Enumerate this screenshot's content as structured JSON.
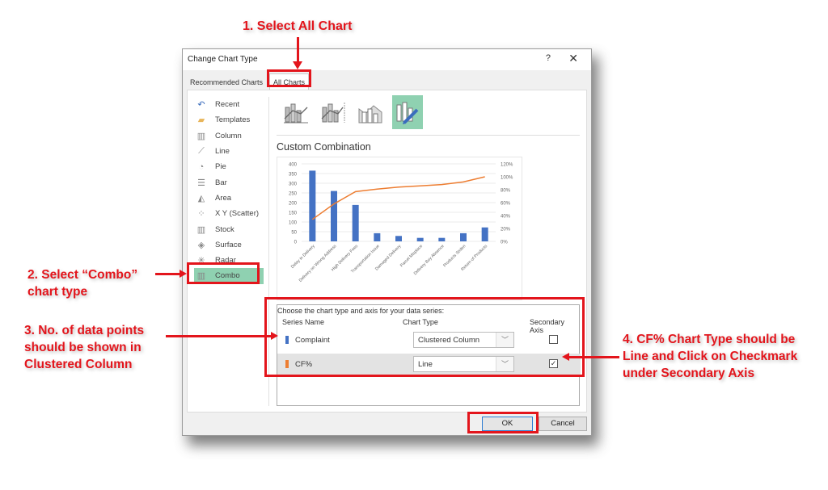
{
  "dialog": {
    "title": "Change Chart Type",
    "help_label": "?",
    "close_label": "✕",
    "tabs": [
      {
        "label": "Recommended Charts",
        "selected": false
      },
      {
        "label": "All Charts",
        "selected": true
      }
    ],
    "chart_types": [
      {
        "label": "Recent",
        "icon": "recent-icon",
        "glyph": "↶",
        "color": "#3b6dbd"
      },
      {
        "label": "Templates",
        "icon": "folder-icon",
        "glyph": "▰",
        "color": "#e8b55a"
      },
      {
        "label": "Column",
        "icon": "column-chart-icon",
        "glyph": "▥"
      },
      {
        "label": "Line",
        "icon": "line-chart-icon",
        "glyph": "⟋"
      },
      {
        "label": "Pie",
        "icon": "pie-chart-icon",
        "glyph": "◔"
      },
      {
        "label": "Bar",
        "icon": "bar-chart-icon",
        "glyph": "☰"
      },
      {
        "label": "Area",
        "icon": "area-chart-icon",
        "glyph": "◭"
      },
      {
        "label": "X Y (Scatter)",
        "icon": "scatter-chart-icon",
        "glyph": "⁘"
      },
      {
        "label": "Stock",
        "icon": "stock-chart-icon",
        "glyph": "▥"
      },
      {
        "label": "Surface",
        "icon": "surface-chart-icon",
        "glyph": "◈"
      },
      {
        "label": "Radar",
        "icon": "radar-chart-icon",
        "glyph": "✳"
      },
      {
        "label": "Combo",
        "icon": "combo-chart-icon",
        "glyph": "▥",
        "selected": true
      }
    ],
    "subtypes": [
      {
        "name": "clustered-column-line",
        "selected": false
      },
      {
        "name": "clustered-column-line-secondary-axis",
        "selected": false
      },
      {
        "name": "stacked-area-clustered-column",
        "selected": false
      },
      {
        "name": "custom-combination",
        "selected": true
      }
    ],
    "combo_title": "Custom Combination",
    "series_section": {
      "caption": "Choose the chart type and axis for your data series:",
      "headers": {
        "series_name": "Series Name",
        "chart_type": "Chart Type",
        "secondary_axis": "Secondary Axis"
      },
      "rows": [
        {
          "name": "Complaint",
          "color": "#4472c4",
          "chart_type": "Clustered Column",
          "secondary_axis": false,
          "check_glyph": ""
        },
        {
          "name": "CF%",
          "color": "#ed7d31",
          "chart_type": "Line",
          "secondary_axis": true,
          "check_glyph": "✓"
        }
      ]
    },
    "buttons": {
      "ok": "OK",
      "cancel": "Cancel"
    }
  },
  "annotations": {
    "step1": "1. Select All Chart",
    "step2": "2. Select “Combo” chart type",
    "step3": "3. No. of data points should be shown in Clustered Column",
    "step4": "4. CF% Chart Type should be Line and Click on Checkmark under Secondary Axis",
    "color": "#e3151c"
  },
  "chart_data": {
    "type": "bar",
    "title": "",
    "categories": [
      "Delay in Delivery",
      "Delivery on Wrong Address",
      "High Delivery Fees",
      "Transportation Issue",
      "Damaged Delivery",
      "Parcel Misplace",
      "Delivery Boy Absence",
      "Products Stolen",
      "Return of Products"
    ],
    "series": [
      {
        "name": "Complaint",
        "type": "bar",
        "axis": "primary",
        "color": "#4472c4",
        "values": [
          365,
          260,
          188,
          42,
          28,
          18,
          18,
          42,
          72
        ]
      },
      {
        "name": "CF%",
        "type": "line",
        "axis": "secondary",
        "color": "#ed7d31",
        "values": [
          0.34,
          0.58,
          0.77,
          0.81,
          0.84,
          0.86,
          0.88,
          0.92,
          1.0
        ]
      }
    ],
    "y_left": {
      "ylim": [
        0,
        400
      ],
      "ticks": [
        "0",
        "50",
        "100",
        "150",
        "200",
        "250",
        "300",
        "350",
        "400"
      ]
    },
    "y_right": {
      "ylim": [
        0,
        1.2
      ],
      "ticks": [
        "0%",
        "20%",
        "40%",
        "60%",
        "80%",
        "100%",
        "120%"
      ]
    },
    "grid": true,
    "legend": "none"
  }
}
